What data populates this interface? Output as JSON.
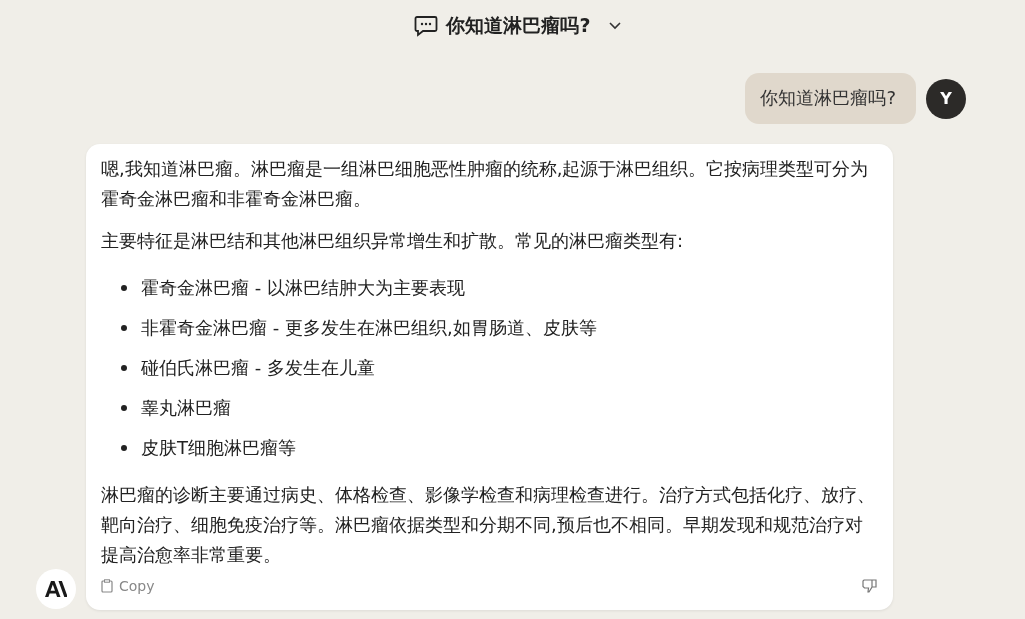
{
  "header": {
    "title": "你知道淋巴瘤吗?"
  },
  "user_message": {
    "text": "你知道淋巴瘤吗?",
    "avatar": "Y"
  },
  "assistant_message": {
    "blocks": [
      {
        "kind": "paragraph",
        "text": "嗯,我知道淋巴瘤。淋巴瘤是一组淋巴细胞恶性肿瘤的统称,起源于淋巴组织。它按病理类型可分为霍奇金淋巴瘤和非霍奇金淋巴瘤。"
      },
      {
        "kind": "paragraph",
        "text": "主要特征是淋巴结和其他淋巴组织异常增生和扩散。常见的淋巴瘤类型有:"
      },
      {
        "kind": "list",
        "items": [
          "霍奇金淋巴瘤 - 以淋巴结肿大为主要表现",
          "非霍奇金淋巴瘤 - 更多发生在淋巴组织,如胃肠道、皮肤等",
          "碰伯氏淋巴瘤 - 多发生在儿童",
          "睾丸淋巴瘤",
          "皮肤T细胞淋巴瘤等"
        ]
      },
      {
        "kind": "paragraph",
        "text": "淋巴瘤的诊断主要通过病史、体格检查、影像学检查和病理检查进行。治疗方式包括化疗、放疗、靶向治疗、细胞免疫治疗等。淋巴瘤依据类型和分期不同,预后也不相同。早期发现和规范治疗对提高治愈率非常重要。"
      }
    ],
    "copy_label": "Copy"
  }
}
